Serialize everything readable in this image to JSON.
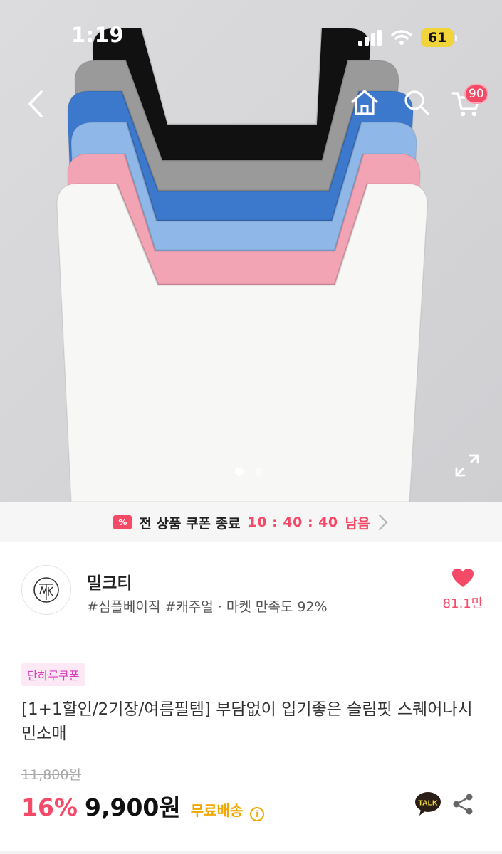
{
  "status_bar": {
    "time": "1:19",
    "battery": "61",
    "battery_color": "#f0d43a"
  },
  "header": {
    "cart_count": "90",
    "badge_color": "#f44a67"
  },
  "gallery": {
    "total_images": 2,
    "current_index": 1,
    "garment_colors": [
      "#111111",
      "#9a9a9a",
      "#3c78cc",
      "#8fb8e8",
      "#f2a4b4",
      "#f7f7f5"
    ]
  },
  "coupon_banner": {
    "ticket_glyph": "%",
    "text": "전 상품 쿠폰 종료",
    "timer": "10 : 40 : 40",
    "remain": "남음"
  },
  "shop": {
    "name": "밀크티",
    "meta": "#심플베이직 #캐주얼 · 마켓 만족도 92%",
    "likes": "81.1만"
  },
  "product": {
    "badge": "단하루쿠폰",
    "title": "[1+1할인/2기장/여름필템] 부담없이 입기좋은 슬림핏 스퀘어나시 민소매",
    "original_price": "11,800원",
    "discount": "16%",
    "price": "9,900원",
    "shipping": "무료배송",
    "info_glyph": "i"
  },
  "accent_color": "#f44a67"
}
